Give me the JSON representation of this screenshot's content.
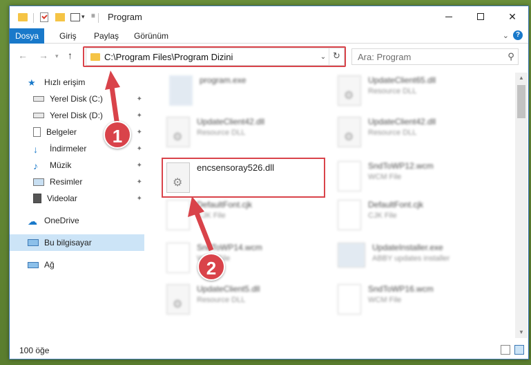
{
  "window": {
    "title": "Program"
  },
  "ribbon": {
    "tabs": [
      "Dosya",
      "Giriş",
      "Paylaş",
      "Görünüm"
    ]
  },
  "address": {
    "path": "C:\\Program Files\\Program Dizini"
  },
  "search": {
    "placeholder": "Ara: Program"
  },
  "sidebar": {
    "items": [
      {
        "label": "Hızlı erişim"
      },
      {
        "label": "Yerel Disk (C:)"
      },
      {
        "label": "Yerel Disk (D:)"
      },
      {
        "label": "Belgeler"
      },
      {
        "label": "İndirmeler"
      },
      {
        "label": "Müzik"
      },
      {
        "label": "Resimler"
      },
      {
        "label": "Videolar"
      },
      {
        "label": "OneDrive"
      },
      {
        "label": "Bu bilgisayar"
      },
      {
        "label": "Ağ"
      }
    ]
  },
  "files": [
    {
      "name": "program.exe",
      "type": ""
    },
    {
      "name": "UpdateClient65.dll",
      "type": "Resource DLL"
    },
    {
      "name": "UpdateClient42.dll",
      "type": "Resource DLL"
    },
    {
      "name": "UpdateClient42.dll",
      "type": "Resource DLL"
    },
    {
      "name": "encsensoray526.dll",
      "type": ""
    },
    {
      "name": "SndToWP12.wcm",
      "type": "WCM File"
    },
    {
      "name": "DefaultFont.cjk",
      "type": "CJK File"
    },
    {
      "name": "DefaultFont.cjk",
      "type": "CJK File"
    },
    {
      "name": "SndToWP14.wcm",
      "type": "WCM File"
    },
    {
      "name": "UpdateInstaller.exe",
      "type": "ABBY updates installer"
    },
    {
      "name": "UpdateClient5.dll",
      "type": "Resource DLL"
    },
    {
      "name": "SndToWP16.wcm",
      "type": "WCM File"
    }
  ],
  "status": {
    "count": "100 öğe"
  },
  "callouts": {
    "one": "1",
    "two": "2"
  },
  "colors": {
    "accent": "#1979ca",
    "highlight": "#d9434a",
    "selected": "#cce4f7"
  }
}
